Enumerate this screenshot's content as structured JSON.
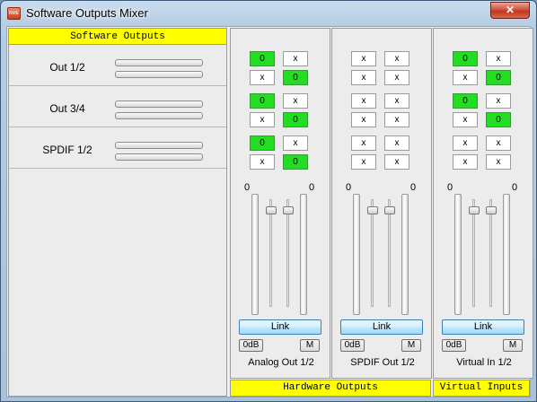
{
  "window": {
    "title": "Software Outputs Mixer",
    "icon_text": "RME",
    "close_glyph": "✕"
  },
  "software_outputs": {
    "header": "Software Outputs",
    "rows": [
      {
        "label": "Out 1/2"
      },
      {
        "label": "Out 3/4"
      },
      {
        "label": "SPDIF 1/2"
      }
    ]
  },
  "hardware_channels": [
    {
      "name": "Analog Out 1/2",
      "grid": [
        [
          "0",
          "x"
        ],
        [
          "x",
          "0"
        ],
        [
          "0",
          "x"
        ],
        [
          "x",
          "0"
        ],
        [
          "0",
          "x"
        ],
        [
          "x",
          "0"
        ]
      ],
      "active": [
        [
          true,
          false
        ],
        [
          false,
          true
        ],
        [
          true,
          false
        ],
        [
          false,
          true
        ],
        [
          true,
          false
        ],
        [
          false,
          true
        ]
      ],
      "left_level_label": "0",
      "right_level_label": "0",
      "link_label": "Link",
      "zero_db_label": "0dB",
      "mute_label": "M"
    },
    {
      "name": "SPDIF Out 1/2",
      "grid": [
        [
          "x",
          "x"
        ],
        [
          "x",
          "x"
        ],
        [
          "x",
          "x"
        ],
        [
          "x",
          "x"
        ],
        [
          "x",
          "x"
        ],
        [
          "x",
          "x"
        ]
      ],
      "active": [
        [
          false,
          false
        ],
        [
          false,
          false
        ],
        [
          false,
          false
        ],
        [
          false,
          false
        ],
        [
          false,
          false
        ],
        [
          false,
          false
        ]
      ],
      "left_level_label": "0",
      "right_level_label": "0",
      "link_label": "Link",
      "zero_db_label": "0dB",
      "mute_label": "M"
    },
    {
      "name": "Virtual In 1/2",
      "grid": [
        [
          "0",
          "x"
        ],
        [
          "x",
          "0"
        ],
        [
          "0",
          "x"
        ],
        [
          "x",
          "0"
        ],
        [
          "x",
          "x"
        ],
        [
          "x",
          "x"
        ]
      ],
      "active": [
        [
          true,
          false
        ],
        [
          false,
          true
        ],
        [
          true,
          false
        ],
        [
          false,
          true
        ],
        [
          false,
          false
        ],
        [
          false,
          false
        ]
      ],
      "left_level_label": "0",
      "right_level_label": "0",
      "link_label": "Link",
      "zero_db_label": "0dB",
      "mute_label": "M"
    }
  ],
  "footers": {
    "hardware_outputs": "Hardware Outputs",
    "virtual_inputs": "Virtual Inputs"
  }
}
